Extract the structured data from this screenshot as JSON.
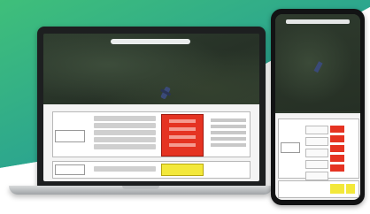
{
  "background": {
    "gradient_start": "#3fbf7a",
    "gradient_end": "#1b8fa0",
    "diagonal_color": "#ffffff"
  },
  "laptop": {
    "bezel_color": "#1d1f20",
    "screen_content": "aerial-map-with-drone",
    "status_colors": {
      "alert": "#e53322",
      "warning": "#f3e83a"
    }
  },
  "phone": {
    "bezel_color": "#121314",
    "screen_content": "aerial-map-with-drone",
    "status_colors": {
      "alert": "#e53322",
      "warning": "#f3e83a"
    }
  }
}
